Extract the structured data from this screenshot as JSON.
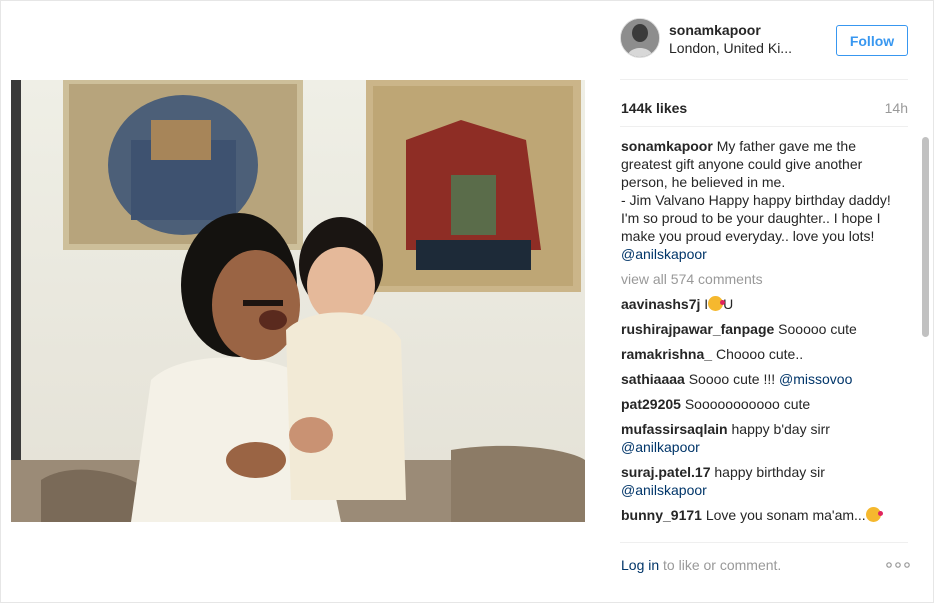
{
  "post": {
    "username": "sonamkapoor",
    "location": "London, United Kingdom",
    "follow_label": "Follow",
    "likes": "144k likes",
    "time_ago": "14h"
  },
  "caption": {
    "username": "sonamkapoor",
    "text": "My father gave me the greatest gift anyone could give another person, he believed in me.\n- Jim Valvano Happy happy birthday daddy! I'm so proud to be your daughter.. I hope I make you proud everyday.. love you lots! ",
    "mention": "@anilskapoor"
  },
  "view_all": "view all 574 comments",
  "comments": [
    {
      "username": "aavinashs7j",
      "before": "I",
      "has_emoji": true,
      "after": "U",
      "mention": ""
    },
    {
      "username": "rushirajpawar_fanpage",
      "before": "Sooooo cute",
      "has_emoji": false,
      "after": "",
      "mention": ""
    },
    {
      "username": "ramakrishna_",
      "before": "Choooo cute..",
      "has_emoji": false,
      "after": "",
      "mention": ""
    },
    {
      "username": "sathiaaaa",
      "before": "Soooo cute !!! ",
      "has_emoji": false,
      "after": "",
      "mention": "@missovoo"
    },
    {
      "username": "pat29205",
      "before": "Sooooooooooo cute",
      "has_emoji": false,
      "after": "",
      "mention": ""
    },
    {
      "username": "mufassirsaqlain",
      "before": "happy b'day sirr ",
      "has_emoji": false,
      "after": "",
      "mention": "@anilkapoor"
    },
    {
      "username": "suraj.patel.17",
      "before": "happy birthday sir ",
      "has_emoji": false,
      "after": "",
      "mention": "@anilskapoor"
    },
    {
      "username": "bunny_9171",
      "before": "Love you sonam ma'am...",
      "has_emoji": true,
      "after": "",
      "mention": ""
    }
  ],
  "footer": {
    "login_label": "Log in",
    "rest": " to like or comment.",
    "more_icon": "ellipsis-icon"
  },
  "colors": {
    "link_blue": "#003569",
    "follow_blue": "#3897f0",
    "muted": "#999999",
    "text": "#262626"
  }
}
